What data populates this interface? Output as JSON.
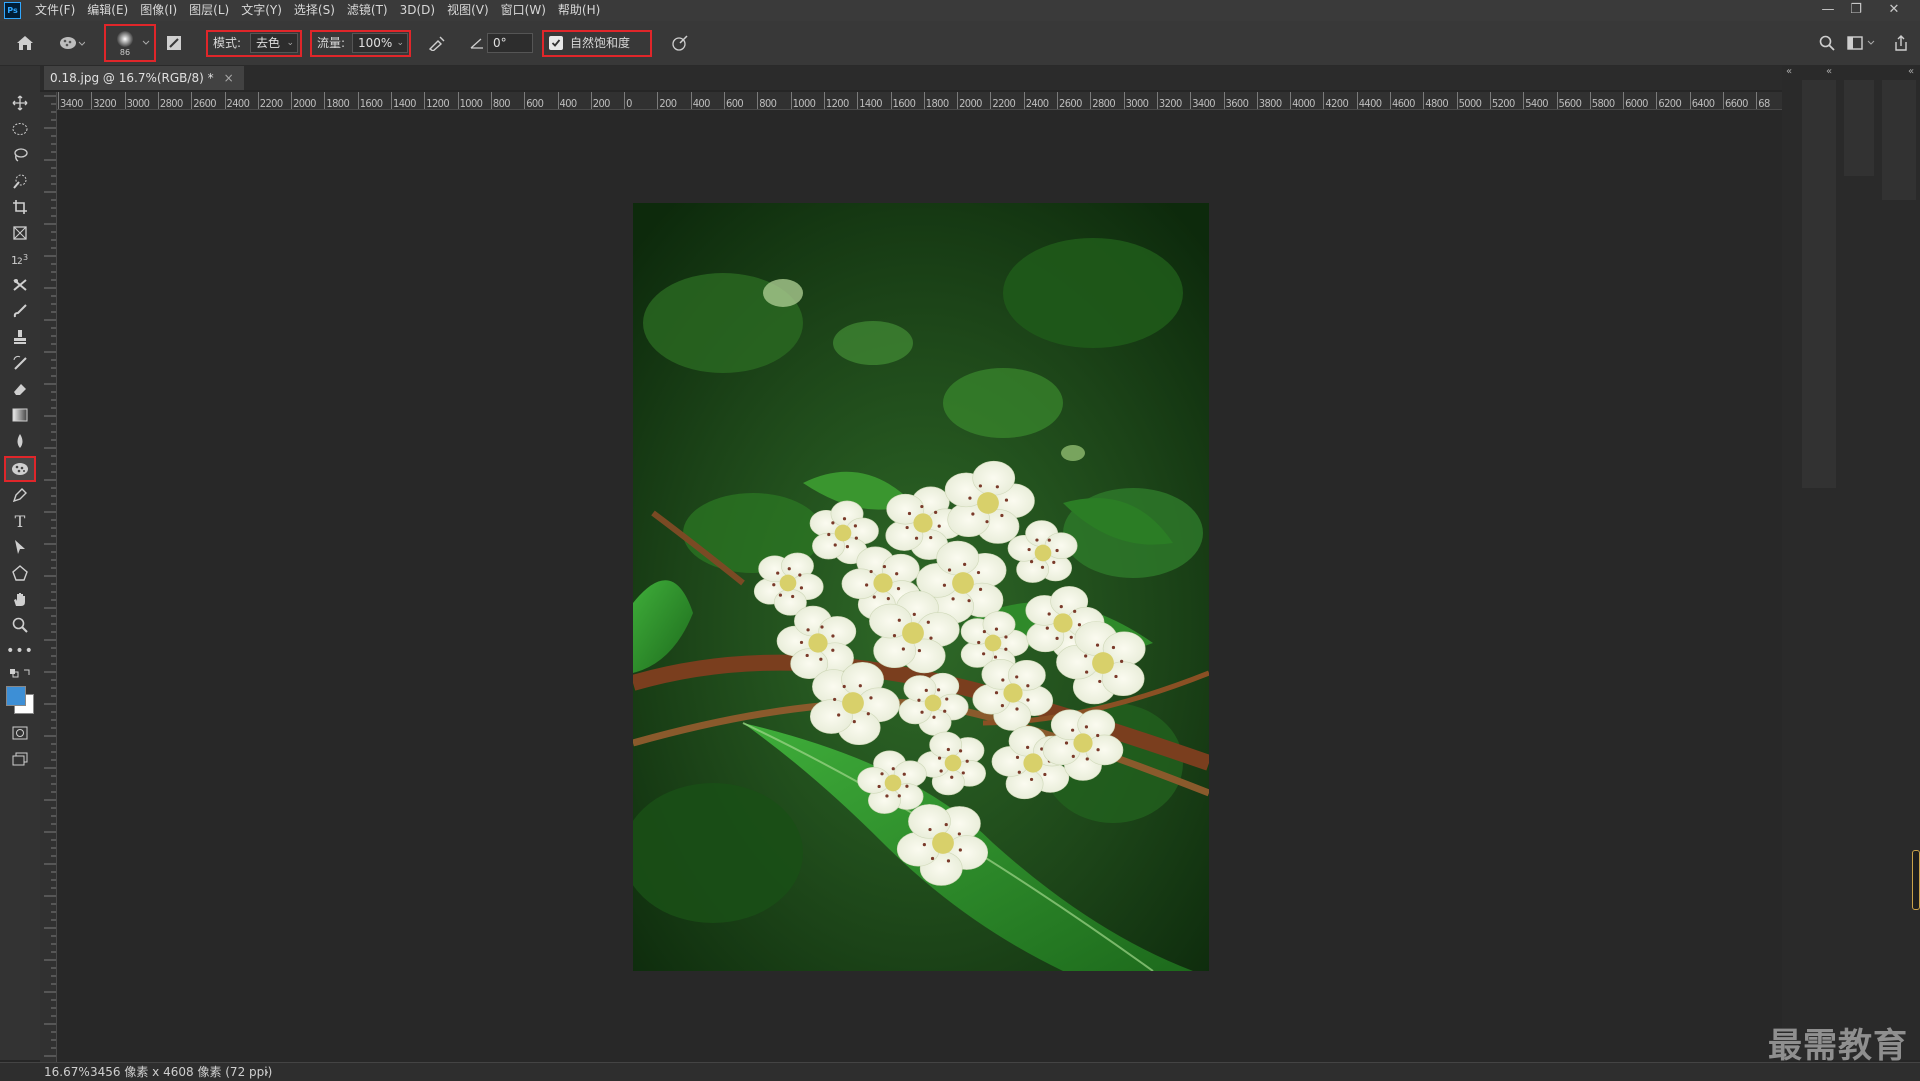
{
  "app": {
    "logo": "Ps"
  },
  "menu": [
    "文件(F)",
    "编辑(E)",
    "图像(I)",
    "图层(L)",
    "文字(Y)",
    "选择(S)",
    "滤镜(T)",
    "3D(D)",
    "视图(V)",
    "窗口(W)",
    "帮助(H)"
  ],
  "window_controls": {
    "minimize": "—",
    "restore": "❐",
    "close": "✕"
  },
  "options": {
    "brush_size": "86",
    "mode_label": "模式:",
    "mode_value": "去色",
    "flow_label": "流量:",
    "flow_value": "100%",
    "angle_value": "0°",
    "vibrance_label": "自然饱和度",
    "vibrance_checked": true
  },
  "document": {
    "tab_title": "0.18.jpg @ 16.7%(RGB/8) *",
    "close": "×"
  },
  "ruler": {
    "labels": [
      "3400",
      "3200",
      "3000",
      "2800",
      "2600",
      "2400",
      "2200",
      "2000",
      "1800",
      "1600",
      "1400",
      "1200",
      "1000",
      "800",
      "600",
      "400",
      "200",
      "0",
      "200",
      "400",
      "600",
      "800",
      "1000",
      "1200",
      "1400",
      "1600",
      "1800",
      "2000",
      "2200",
      "2400",
      "2600",
      "2800",
      "3000",
      "3200",
      "3400",
      "3600",
      "3800",
      "4000",
      "4200",
      "4400",
      "4600",
      "4800",
      "5000",
      "5200",
      "5400",
      "5600",
      "5800",
      "6000",
      "6200",
      "6400",
      "6600",
      "68"
    ]
  },
  "status": {
    "zoom": "16.67%",
    "info": "3456 像素 x 4608 像素 (72 ppi)",
    "arrow": "›"
  },
  "watermark": "最需教育",
  "colors": {
    "foreground": "#3d8fd6",
    "background": "#ffffff",
    "highlight": "#e0262a"
  },
  "icons": {
    "toolbar": [
      "move-icon",
      "marquee-icon",
      "lasso-icon",
      "quick-select-icon",
      "crop-icon",
      "frame-icon",
      "eyedropper-icon",
      "healing-icon",
      "brush-icon",
      "stamp-icon",
      "history-brush-icon",
      "eraser-icon",
      "gradient-icon",
      "blur-icon",
      "sponge-icon",
      "pen-icon",
      "type-icon",
      "path-select-icon",
      "shape-icon",
      "hand-icon",
      "zoom-icon",
      "more-icon"
    ]
  }
}
